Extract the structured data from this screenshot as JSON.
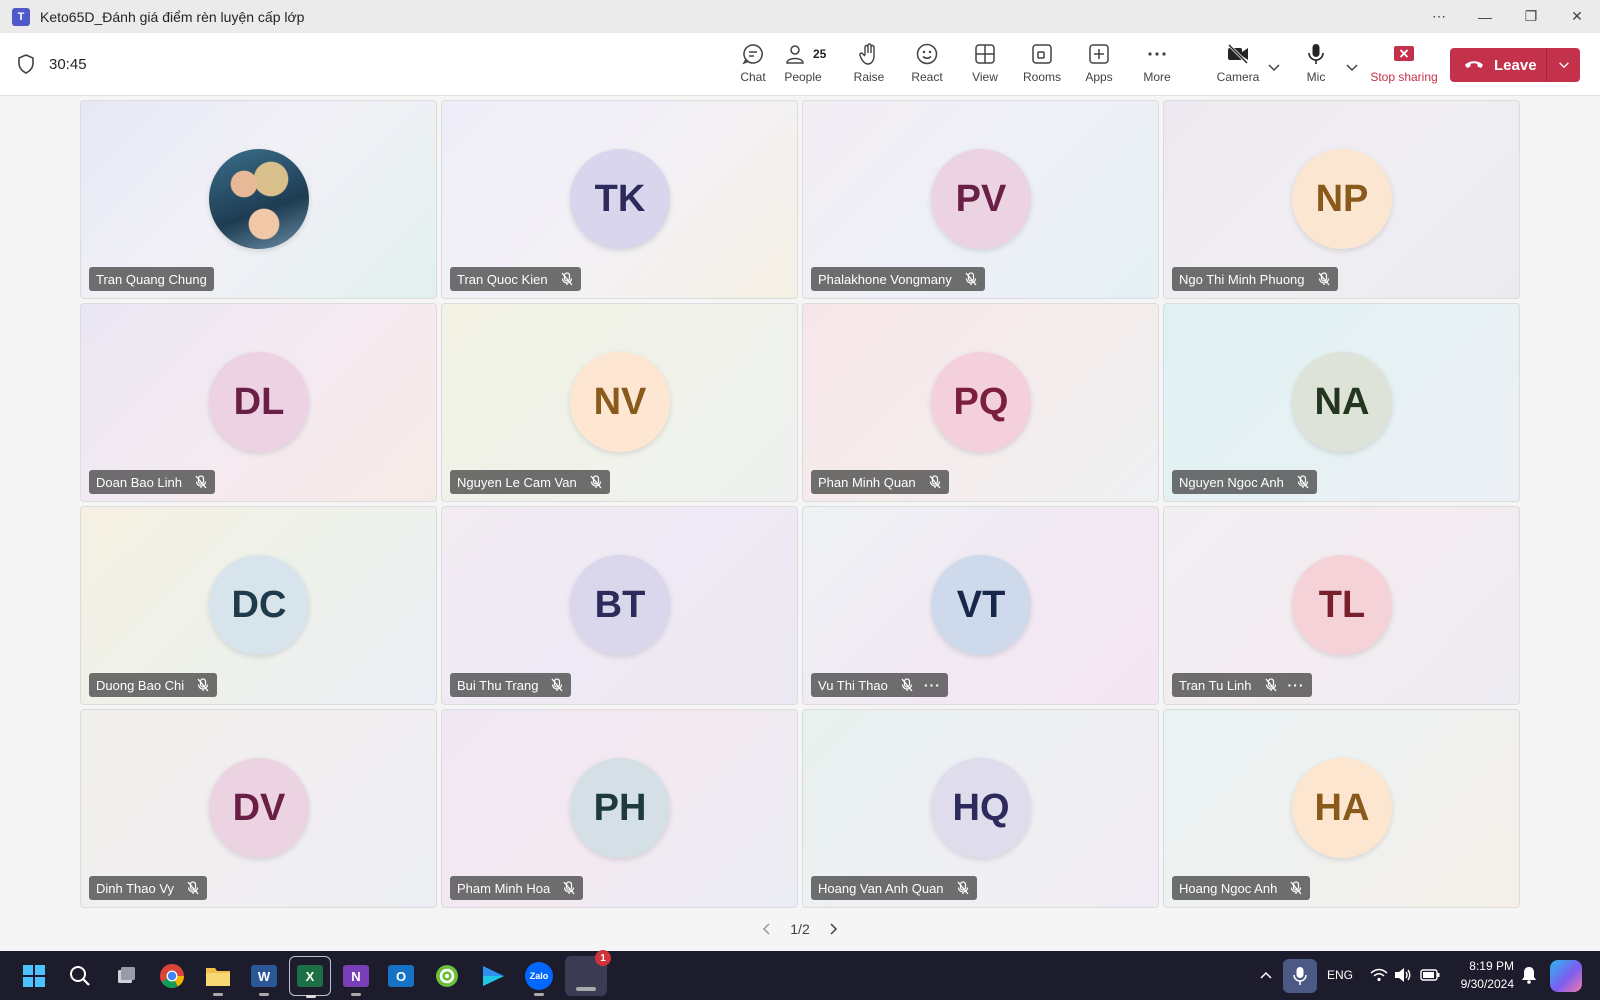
{
  "window": {
    "title": "Keto65D_Đánh giá điểm rèn luyện cấp lớp",
    "controls": [
      "more-icon",
      "minimize-icon",
      "restore-icon",
      "close-icon"
    ]
  },
  "meeting": {
    "timer": "30:45",
    "toolbar": {
      "chat": "Chat",
      "people": "People",
      "people_count": "25",
      "raise": "Raise",
      "react": "React",
      "view": "View",
      "rooms": "Rooms",
      "apps": "Apps",
      "more": "More",
      "camera": "Camera",
      "mic": "Mic",
      "stop_sharing": "Stop sharing",
      "leave": "Leave"
    },
    "colors": {
      "leave": "#c4314b",
      "stop_sharing": "#c4314b"
    },
    "participants": [
      {
        "name": "Tran Quang Chung",
        "initials": "",
        "photo": true,
        "muted": false,
        "more": false,
        "avatar_bg": "",
        "avatar_fg": "",
        "tile_bg": "linear-gradient(135deg,#e6e8f5,#f1f0f6 45%,#e3f0ef)"
      },
      {
        "name": "Tran Quoc Kien",
        "initials": "TK",
        "photo": false,
        "muted": true,
        "more": false,
        "avatar_bg": "#d9d5ec",
        "avatar_fg": "#2d2a5c",
        "tile_bg": "linear-gradient(135deg,#eeeef8,#f3f1f6 50%,#f4f0e4)"
      },
      {
        "name": "Phalakhone Vongmany",
        "initials": "PV",
        "photo": false,
        "muted": true,
        "more": false,
        "avatar_bg": "#ecd3e2",
        "avatar_fg": "#6a1f46",
        "tile_bg": "linear-gradient(135deg,#f3ecf3,#eef0f7 50%,#e5f0f4)"
      },
      {
        "name": "Ngo Thi Minh Phuong",
        "initials": "NP",
        "photo": false,
        "muted": true,
        "more": false,
        "avatar_bg": "#fbe6d2",
        "avatar_fg": "#8a5a1c",
        "tile_bg": "linear-gradient(135deg,#eceaf0,#f0eef2 50%,#ebebee)"
      },
      {
        "name": "Doan Bao Linh",
        "initials": "DL",
        "photo": false,
        "muted": true,
        "more": false,
        "avatar_bg": "#ecd2e2",
        "avatar_fg": "#6a1f46",
        "tile_bg": "linear-gradient(135deg,#eae6f3,#f4eaf1 50%,#f5ebe6)"
      },
      {
        "name": "Nguyen Le Cam Van",
        "initials": "NV",
        "photo": false,
        "muted": true,
        "more": false,
        "avatar_bg": "#fde7d2",
        "avatar_fg": "#8a5a1c",
        "tile_bg": "linear-gradient(135deg,#f2f3e4,#f0f2ea 50%,#eef0ef)"
      },
      {
        "name": "Phan Minh Quan",
        "initials": "PQ",
        "photo": false,
        "muted": true,
        "more": false,
        "avatar_bg": "#f4d0dc",
        "avatar_fg": "#7a1f3c",
        "tile_bg": "linear-gradient(135deg,#f6e6ea,#f5ecec 50%,#eef0f2)"
      },
      {
        "name": "Nguyen Ngoc Anh",
        "initials": "NA",
        "photo": false,
        "muted": true,
        "more": false,
        "avatar_bg": "#dde3d8",
        "avatar_fg": "#24361f",
        "tile_bg": "linear-gradient(135deg,#e0f1f3,#e6f1f3 50%,#ecf0f4)"
      },
      {
        "name": "Duong Bao Chi",
        "initials": "DC",
        "photo": false,
        "muted": true,
        "more": false,
        "avatar_bg": "#d8e4ec",
        "avatar_fg": "#1f3a4a",
        "tile_bg": "linear-gradient(135deg,#f5f0e2,#eef1ea 50%,#ebeef4)"
      },
      {
        "name": "Bui Thu Trang",
        "initials": "BT",
        "photo": false,
        "muted": true,
        "more": false,
        "avatar_bg": "#dad6ec",
        "avatar_fg": "#2d2a5c",
        "tile_bg": "linear-gradient(135deg,#f2ebf2,#eee9f4 50%,#ece8f1)"
      },
      {
        "name": "Vu Thi Thao",
        "initials": "VT",
        "photo": false,
        "muted": true,
        "more": true,
        "avatar_bg": "#cfd9ec",
        "avatar_fg": "#18284a",
        "tile_bg": "linear-gradient(135deg,#eef2f4,#f1e9f3 50%,#f3e6f2)"
      },
      {
        "name": "Tran Tu Linh",
        "initials": "TL",
        "photo": false,
        "muted": true,
        "more": true,
        "avatar_bg": "#f4d2d8",
        "avatar_fg": "#7a1f2c",
        "tile_bg": "linear-gradient(135deg,#f1eef2,#f3ecf0 50%,#ecebf1)"
      },
      {
        "name": "Dinh Thao Vy",
        "initials": "DV",
        "photo": false,
        "muted": true,
        "more": false,
        "avatar_bg": "#ecd3e2",
        "avatar_fg": "#6a1f46",
        "tile_bg": "linear-gradient(135deg,#f1efec,#f1eef0 50%,#eceef3)"
      },
      {
        "name": "Pham Minh Hoa",
        "initials": "PH",
        "photo": false,
        "muted": true,
        "more": false,
        "avatar_bg": "#d5e0e6",
        "avatar_fg": "#1f3a3f",
        "tile_bg": "linear-gradient(135deg,#efe7f3,#f3e9f1 50%,#eaecf3)"
      },
      {
        "name": "Hoang Van Anh Quan",
        "initials": "HQ",
        "photo": false,
        "muted": true,
        "more": false,
        "avatar_bg": "#dfdcec",
        "avatar_fg": "#2d2a5c",
        "tile_bg": "linear-gradient(135deg,#e7f1ee,#eeeff3 50%,#f1ecf3)"
      },
      {
        "name": "Hoang Ngoc Anh",
        "initials": "HA",
        "photo": false,
        "muted": true,
        "more": false,
        "avatar_bg": "#fde6d0",
        "avatar_fg": "#8a5a1c",
        "tile_bg": "linear-gradient(135deg,#eaf2f3,#eff1f0 50%,#f4efe8)"
      }
    ],
    "pagination": "1/2"
  },
  "taskbar": {
    "apps": [
      {
        "name": "start-icon",
        "label": "",
        "color": "#2f8ff0"
      },
      {
        "name": "search-icon",
        "label": "",
        "color": "transparent"
      },
      {
        "name": "task-view-icon",
        "label": "",
        "color": "transparent"
      },
      {
        "name": "chrome-icon",
        "label": "",
        "color": "#ffffff"
      },
      {
        "name": "file-explorer-icon",
        "label": "",
        "color": "#f3c04c"
      },
      {
        "name": "word-icon",
        "label": "W",
        "color": "#2b5797"
      },
      {
        "name": "excel-icon",
        "label": "X",
        "color": "#1d7044"
      },
      {
        "name": "onenote-icon",
        "label": "N",
        "color": "#7a3fb8"
      },
      {
        "name": "outlook-icon",
        "label": "O",
        "color": "#1672c4"
      },
      {
        "name": "greenshot-icon",
        "label": "",
        "color": "#6cbf3b"
      },
      {
        "name": "media-player-icon",
        "label": "",
        "color": "#2f8ff0"
      },
      {
        "name": "zalo-icon",
        "label": "Zalo",
        "color": "#0068ff"
      },
      {
        "name": "teams-taskbar-icon",
        "label": "",
        "color": "#3b3b54"
      }
    ],
    "teams_badge": "1",
    "language": "ENG",
    "time": "8:19 PM",
    "date": "9/30/2024"
  }
}
